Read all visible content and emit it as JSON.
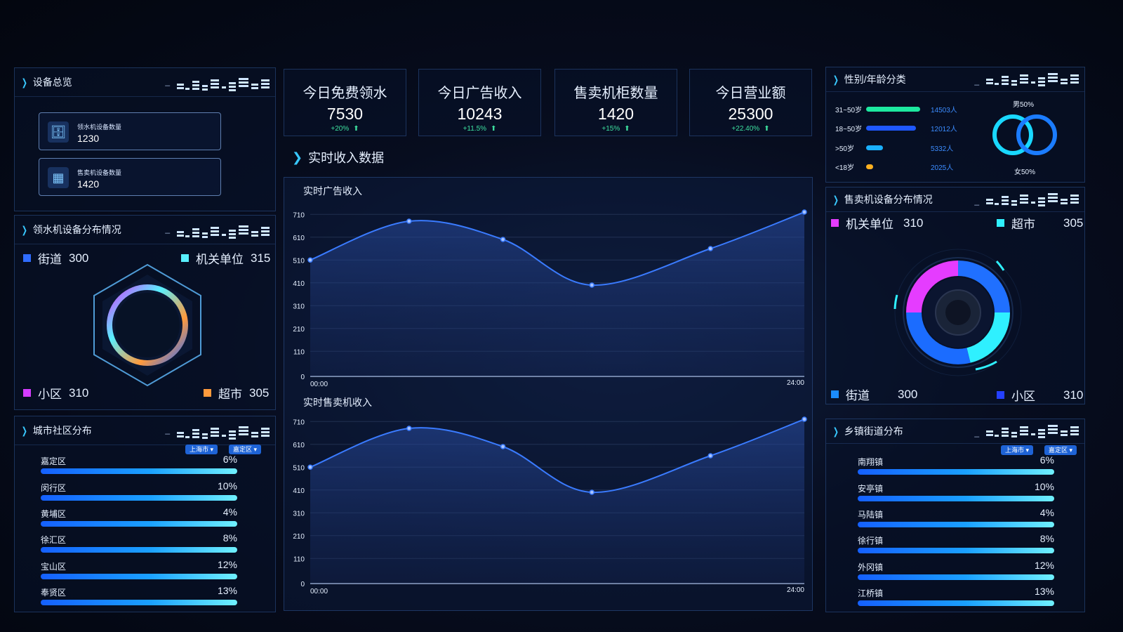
{
  "kpis": [
    {
      "title": "今日免费领水",
      "value": "7530",
      "delta": "+20%"
    },
    {
      "title": "今日广告收入",
      "value": "10243",
      "delta": "+11.5%"
    },
    {
      "title": "售卖机柜数量",
      "value": "1420",
      "delta": "+15%"
    },
    {
      "title": "今日营业额",
      "value": "25300",
      "delta": "+22.40%"
    }
  ],
  "device_overview": {
    "title": "设备总览",
    "minimize": "_",
    "cards": [
      {
        "label": "领水机设备数量",
        "value": "1230",
        "icon": "water-dispenser-icon"
      },
      {
        "label": "售卖机设备数量",
        "value": "1420",
        "icon": "vending-machine-icon"
      }
    ]
  },
  "water_dist": {
    "title": "领水机设备分布情况",
    "minimize": "_",
    "legend": [
      {
        "name": "街道",
        "value": "300",
        "color": "#2f6cff"
      },
      {
        "name": "机关单位",
        "value": "315",
        "color": "#58f0ff"
      },
      {
        "name": "小区",
        "value": "310",
        "color": "#d43cff"
      },
      {
        "name": "超市",
        "value": "305",
        "color": "#ff9a3c"
      }
    ]
  },
  "city_dist": {
    "title": "城市社区分布",
    "minimize": "_",
    "select_city": "上海市",
    "select_district": "嘉定区",
    "rows": [
      {
        "name": "嘉定区",
        "pct": "6%"
      },
      {
        "name": "闵行区",
        "pct": "10%"
      },
      {
        "name": "黄埔区",
        "pct": "4%"
      },
      {
        "name": "徐汇区",
        "pct": "8%"
      },
      {
        "name": "宝山区",
        "pct": "12%"
      },
      {
        "name": "奉贤区",
        "pct": "13%"
      }
    ]
  },
  "realtime": {
    "title": "实时收入数据",
    "charts": [
      {
        "title": "实时广告收入"
      },
      {
        "title": "实时售卖机收入"
      }
    ]
  },
  "chart_data": [
    {
      "type": "line",
      "title": "实时广告收入",
      "x_labels": [
        "00:00",
        "24:00"
      ],
      "yticks": [
        0,
        110,
        210,
        310,
        410,
        510,
        610,
        710
      ],
      "ylim": [
        0,
        720
      ],
      "points": [
        [
          0,
          510
        ],
        [
          0.2,
          680
        ],
        [
          0.39,
          600
        ],
        [
          0.57,
          400
        ],
        [
          0.81,
          560
        ],
        [
          1.0,
          720
        ]
      ],
      "color": "#3a7bff",
      "grid": true
    },
    {
      "type": "line",
      "title": "实时售卖机收入",
      "x_labels": [
        "00:00",
        "24:00"
      ],
      "yticks": [
        0,
        110,
        210,
        310,
        410,
        510,
        610,
        710
      ],
      "ylim": [
        0,
        720
      ],
      "points": [
        [
          0,
          510
        ],
        [
          0.2,
          680
        ],
        [
          0.39,
          600
        ],
        [
          0.57,
          400
        ],
        [
          0.81,
          560
        ],
        [
          1.0,
          720
        ]
      ],
      "color": "#3a7bff",
      "grid": true
    }
  ],
  "gender_age": {
    "title": "性别/年龄分类",
    "minimize": "_",
    "rows": [
      {
        "label": "31~50岁",
        "value": "14503人",
        "color": "#1de9a0",
        "fraction": 0.92
      },
      {
        "label": "18~50岁",
        "value": "12012人",
        "color": "#1f58ff",
        "fraction": 0.85
      },
      {
        "label": ">50岁",
        "value": "5332人",
        "color": "#1ab0ff",
        "fraction": 0.28
      },
      {
        "label": "<18岁",
        "value": "2025人",
        "color": "#ffb020",
        "fraction": 0.12
      }
    ],
    "male": "男50%",
    "female": "女50%"
  },
  "vending_dist": {
    "title": "售卖机设备分布情况",
    "minimize": "_",
    "legend": [
      {
        "name": "机关单位",
        "value": "310",
        "color": "#e53cff"
      },
      {
        "name": "超市",
        "value": "305",
        "color": "#2ff0ff"
      },
      {
        "name": "街道",
        "value": "300",
        "color": "#1b8cff"
      },
      {
        "name": "小区",
        "value": "310",
        "color": "#2440ff"
      }
    ]
  },
  "town_dist": {
    "title": "乡镇街道分布",
    "minimize": "_",
    "select_city": "上海市",
    "select_district": "嘉定区",
    "rows": [
      {
        "name": "南翔镇",
        "pct": "6%"
      },
      {
        "name": "安亭镇",
        "pct": "10%"
      },
      {
        "name": "马陆镇",
        "pct": "4%"
      },
      {
        "name": "徐行镇",
        "pct": "8%"
      },
      {
        "name": "外冈镇",
        "pct": "12%"
      },
      {
        "name": "江桥镇",
        "pct": "13%"
      }
    ]
  }
}
